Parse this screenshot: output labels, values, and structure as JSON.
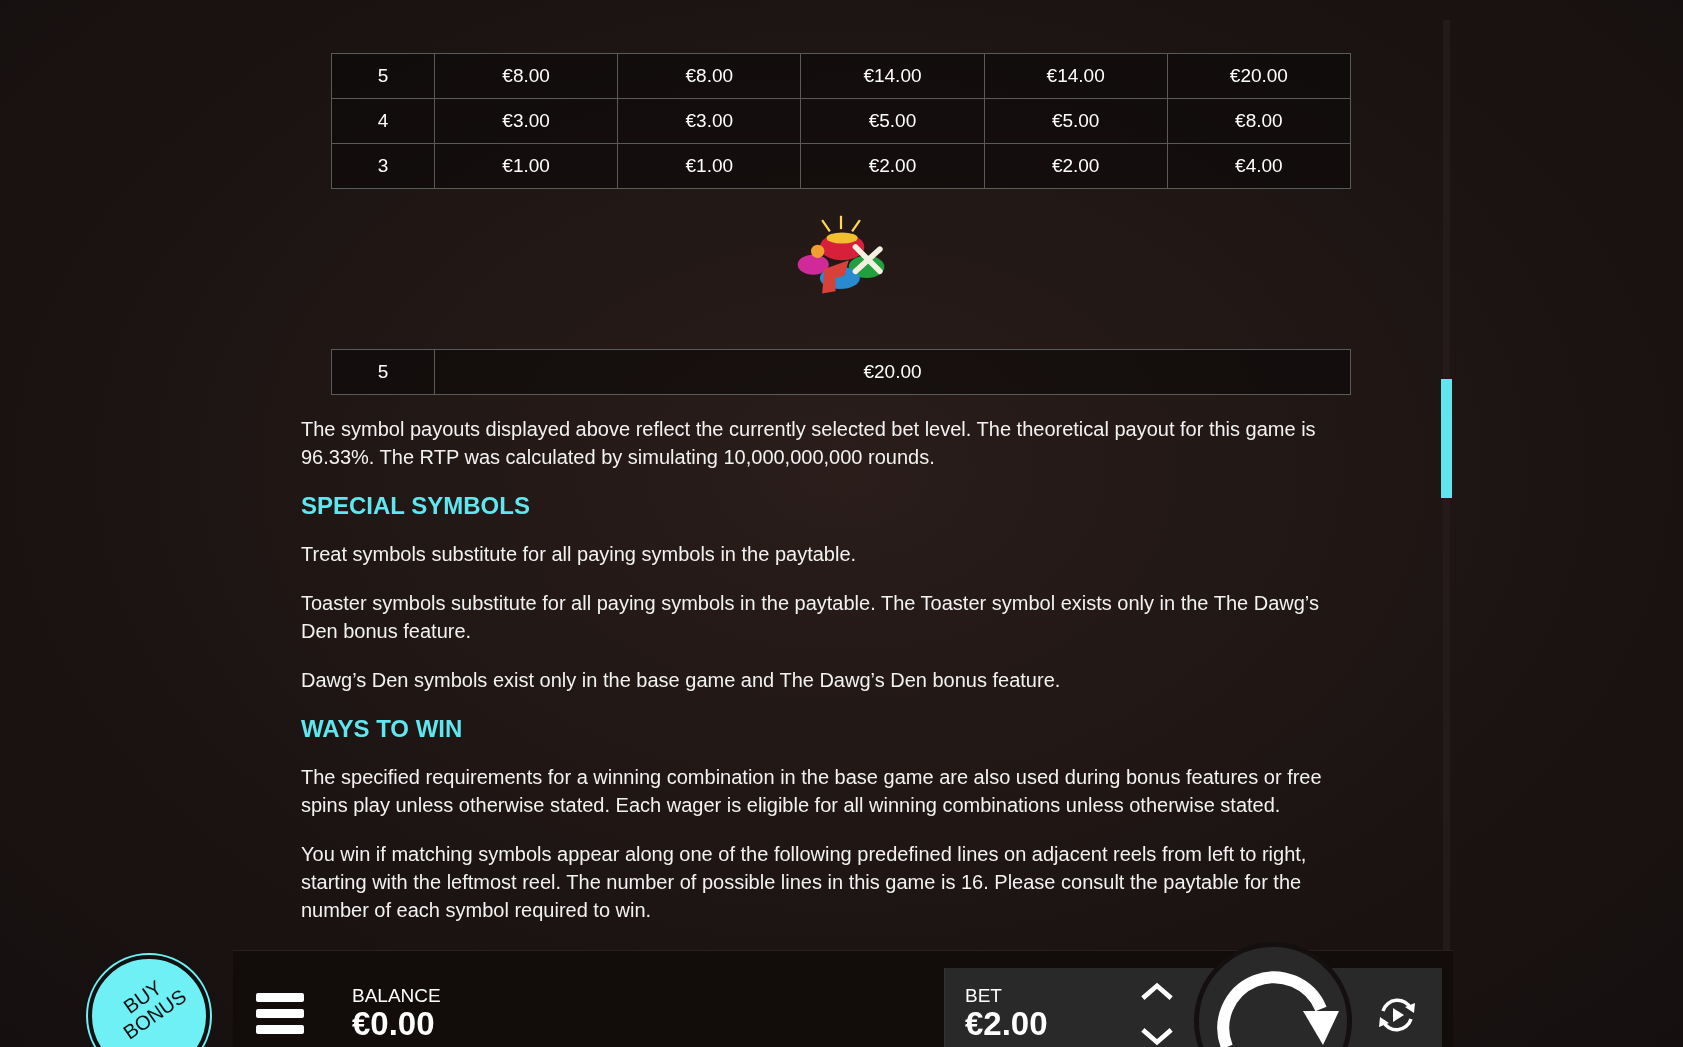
{
  "paytable_top": {
    "rows": [
      {
        "count": "5",
        "payouts": [
          "€8.00",
          "€8.00",
          "€14.00",
          "€14.00",
          "€20.00"
        ]
      },
      {
        "count": "4",
        "payouts": [
          "€3.00",
          "€3.00",
          "€5.00",
          "€5.00",
          "€8.00"
        ]
      },
      {
        "count": "3",
        "payouts": [
          "€1.00",
          "€1.00",
          "€2.00",
          "€2.00",
          "€4.00"
        ]
      }
    ]
  },
  "bonus_symbol_table": {
    "rows": [
      {
        "count": "5",
        "payout": "€20.00"
      }
    ]
  },
  "intro_paragraphs": [
    "The symbol payouts displayed above reflect the currently selected bet level. The theoretical payout for this game is 96.33%. The RTP was calculated by simulating 10,000,000,000 rounds."
  ],
  "sections": [
    {
      "heading": "SPECIAL SYMBOLS",
      "paragraphs": [
        "Treat symbols substitute for all paying symbols in the paytable.",
        "Toaster symbols substitute for all paying symbols in the paytable. The Toaster symbol exists only in the The Dawg’s Den bonus feature.",
        "Dawg’s Den symbols exist only in the base game and The Dawg’s Den bonus feature."
      ]
    },
    {
      "heading": "WAYS TO WIN",
      "paragraphs": [
        "The specified requirements for a winning combination in the base game are also used during bonus features or free spins play unless otherwise stated. Each wager is eligible for all winning combinations unless otherwise stated.",
        "You win if matching symbols appear along one of the following predefined lines on adjacent reels from left to right, starting with the leftmost reel. The number of possible lines in this game is 16. Please consult the paytable for the number of each symbol required to win."
      ]
    }
  ],
  "bottom_bar": {
    "buy_bonus": "BUY BONUS",
    "balance_label": "BALANCE",
    "balance_value": "€0.00",
    "bet_label": "BET",
    "bet_value": "€2.00"
  }
}
